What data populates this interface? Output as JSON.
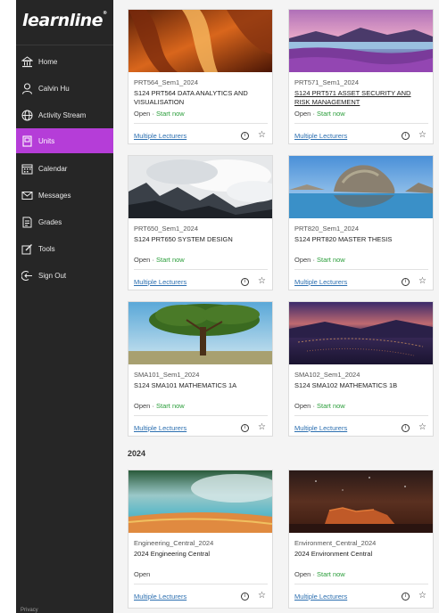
{
  "app": {
    "logo": "learnline"
  },
  "sidebar": {
    "items": [
      {
        "label": "Home",
        "icon": "home-icon"
      },
      {
        "label": "Calvin Hu",
        "icon": "user-icon"
      },
      {
        "label": "Activity Stream",
        "icon": "globe-icon"
      },
      {
        "label": "Units",
        "icon": "units-icon",
        "active": true
      },
      {
        "label": "Calendar",
        "icon": "calendar-icon"
      },
      {
        "label": "Messages",
        "icon": "envelope-icon"
      },
      {
        "label": "Grades",
        "icon": "grades-icon"
      },
      {
        "label": "Tools",
        "icon": "tools-icon"
      },
      {
        "label": "Sign Out",
        "icon": "sign-out-icon"
      }
    ],
    "privacy": "Privacy",
    "active_color": "#b53dd8"
  },
  "section": {
    "year_heading": "2024"
  },
  "cards": [
    {
      "code": "PRT564_Sem1_2024",
      "title": "S124 PRT564 DATA ANALYTICS AND VISUALISATION",
      "status": "Open",
      "start": "Start now",
      "lecturers": "Multiple Lecturers",
      "image": "canyon"
    },
    {
      "code": "PRT571_Sem1_2024",
      "title": "S124 PRT571 ASSET SECURITY AND RISK MANAGEMENT",
      "status": "Open",
      "start": "Start now",
      "lecturers": "Multiple Lecturers",
      "image": "lavender"
    },
    {
      "code": "PRT650_Sem1_2024",
      "title": "S124 PRT650 SYSTEM DESIGN",
      "status": "Open",
      "start": "Start now",
      "lecturers": "Multiple Lecturers",
      "image": "mountain-clouds"
    },
    {
      "code": "PRT820_Sem1_2024",
      "title": "S124 PRT820 MASTER THESIS",
      "status": "Open",
      "start": "Start now",
      "lecturers": "Multiple Lecturers",
      "image": "rocks-lake"
    },
    {
      "code": "SMA101_Sem1_2024",
      "title": "S124 SMA101 MATHEMATICS 1A",
      "status": "Open",
      "start": "Start now",
      "lecturers": "Multiple Lecturers",
      "image": "tree"
    },
    {
      "code": "SMA102_Sem1_2024",
      "title": "S124 SMA102 MATHEMATICS 1B",
      "status": "Open",
      "start": "Start now",
      "lecturers": "Multiple Lecturers",
      "image": "city-night"
    },
    {
      "code": "Engineering_Central_2024",
      "title": "2024 Engineering Central",
      "status": "Open",
      "start": "",
      "lecturers": "Multiple Lecturers",
      "image": "hot-spring"
    },
    {
      "code": "Environment_Central_2024",
      "title": "2024 Environment Central",
      "status": "Open",
      "start": "Start now",
      "lecturers": "Multiple Lecturers",
      "image": "desert-night"
    }
  ],
  "icons": {
    "info": "info-icon",
    "star": "star-icon"
  },
  "colors": {
    "link": "#2c6fb0",
    "start_now": "#2a9d3a",
    "sidebar_bg": "#262626"
  }
}
